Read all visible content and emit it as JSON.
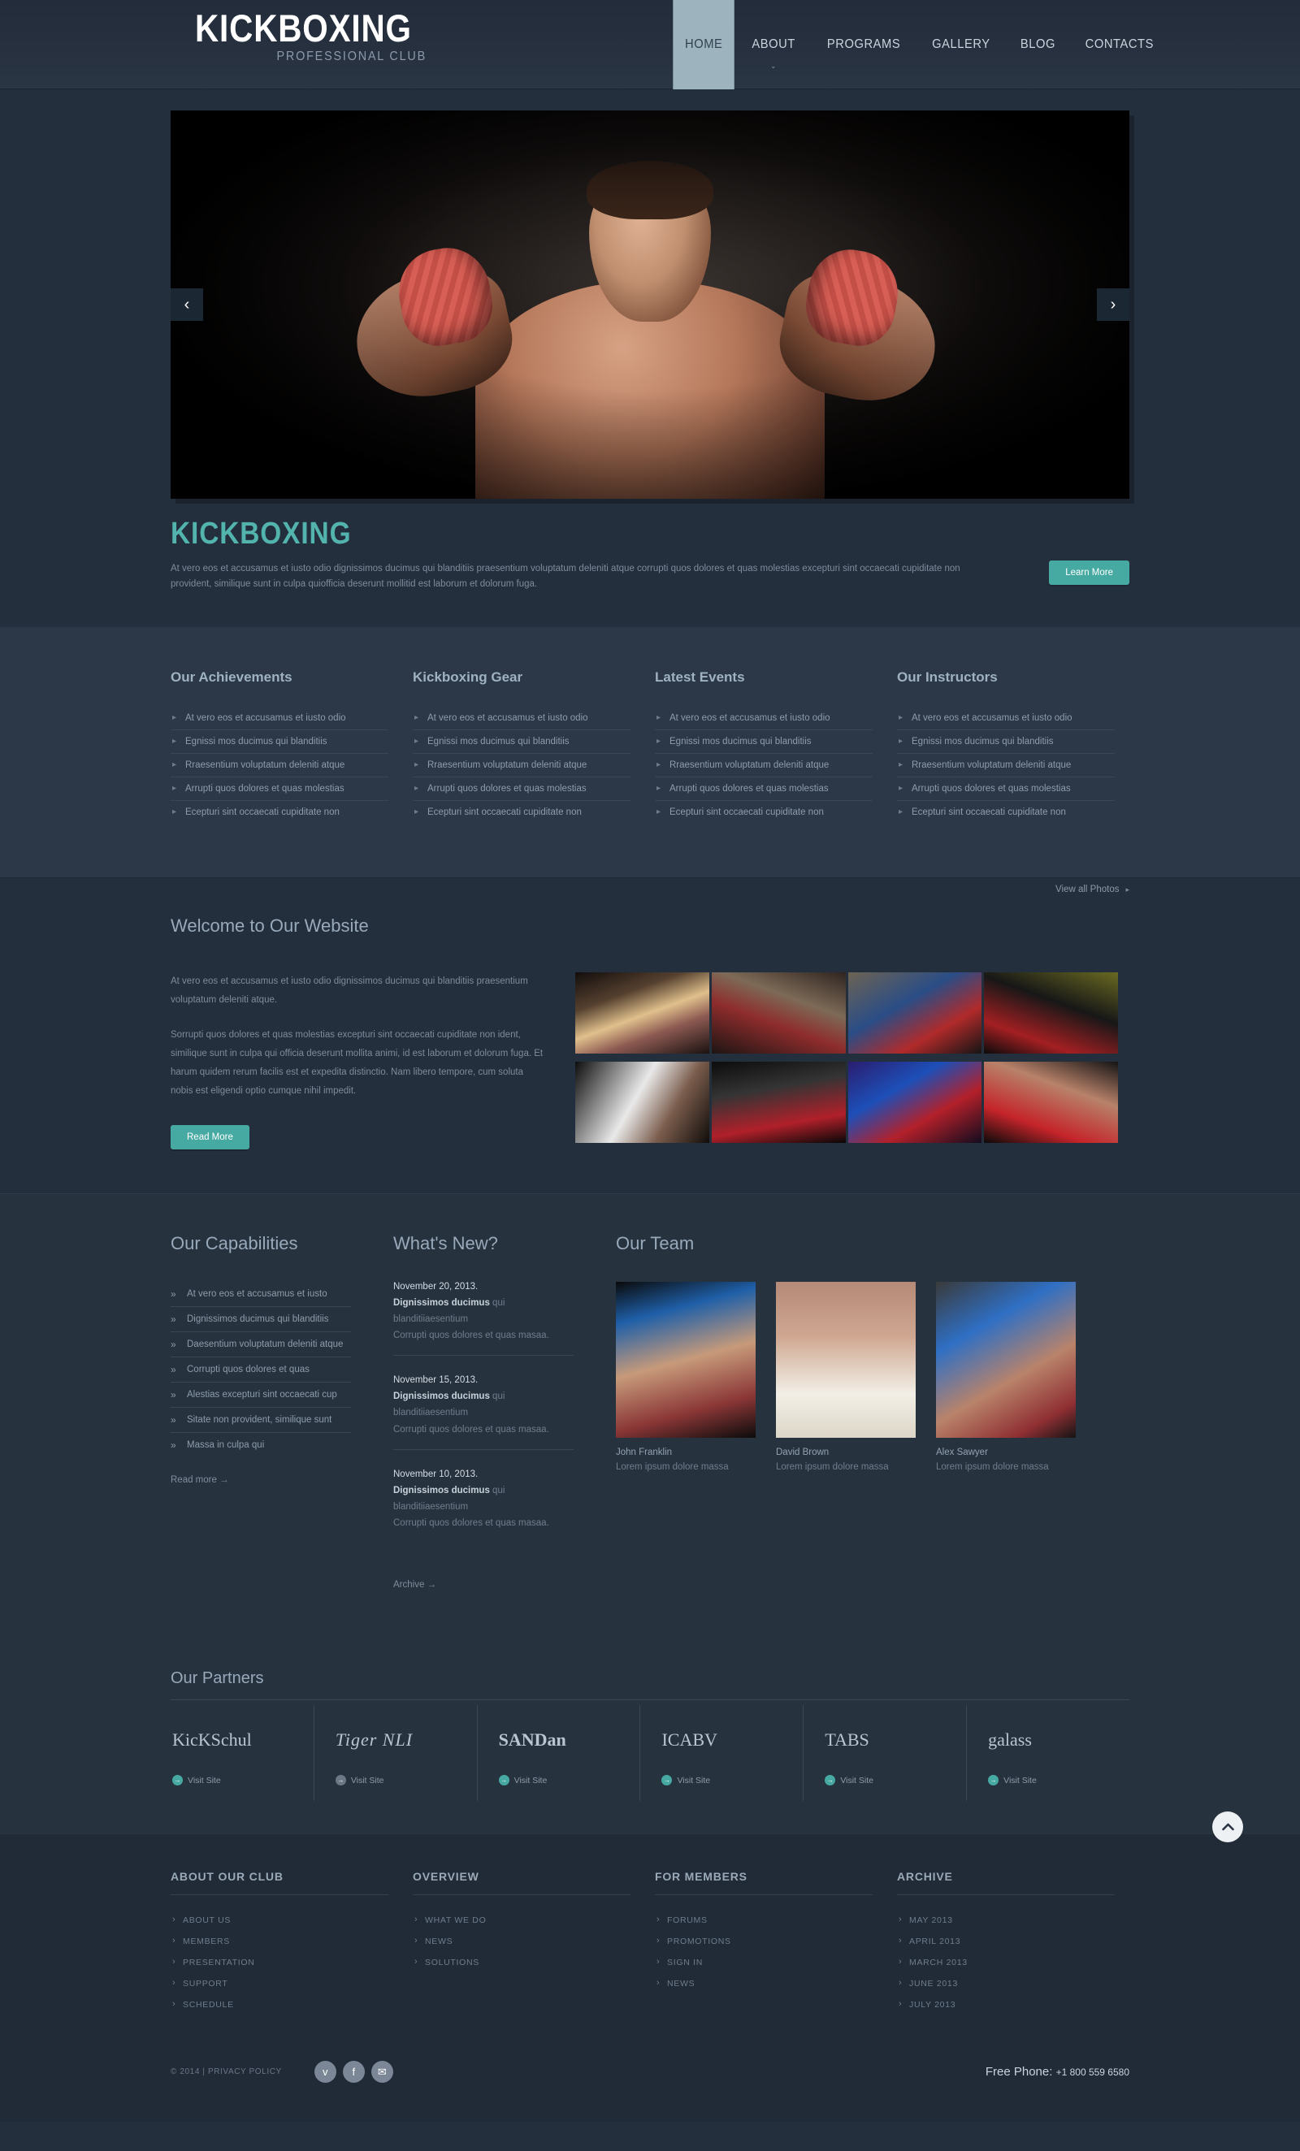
{
  "header": {
    "logo_title": "KICKBOXING",
    "logo_sub": "PROFESSIONAL CLUB",
    "nav": [
      {
        "label": "HOME",
        "active": true,
        "caret": false
      },
      {
        "label": "ABOUT",
        "active": false,
        "caret": true
      },
      {
        "label": "PROGRAMS",
        "active": false,
        "caret": false
      },
      {
        "label": "GALLERY",
        "active": false,
        "caret": false
      },
      {
        "label": "BLOG",
        "active": false,
        "caret": false
      },
      {
        "label": "CONTACTS",
        "active": false,
        "caret": false
      }
    ]
  },
  "slider": {
    "prev": "‹",
    "next": "›",
    "caption_title": "KICKBOXING",
    "caption_text": "At vero eos et accusamus et iusto odio dignissimos ducimus qui blanditiis praesentium voluptatum deleniti atque corrupti quos dolores et quas molestias excepturi sint occaecati cupiditate non provident, similique sunt in culpa quiofficia deserunt mollitid est laborum et dolorum fuga.",
    "button": "Learn More"
  },
  "lists_section": {
    "columns": [
      {
        "title": "Our Achievements",
        "items": [
          "At vero eos et accusamus et iusto odio",
          "Egnissi mos ducimus qui blanditiis",
          "Rraesentium voluptatum deleniti atque",
          "Arrupti quos dolores et quas molestias",
          "Ecepturi sint occaecati cupiditate non"
        ]
      },
      {
        "title": "Kickboxing Gear",
        "items": [
          "At vero eos et accusamus et iusto odio",
          "Egnissi mos ducimus qui blanditiis",
          "Rraesentium voluptatum deleniti atque",
          "Arrupti quos dolores et quas molestias",
          "Ecepturi sint occaecati cupiditate non"
        ]
      },
      {
        "title": "Latest Events",
        "items": [
          "At vero eos et accusamus et iusto odio",
          "Egnissi mos ducimus qui blanditiis",
          "Rraesentium voluptatum deleniti atque",
          "Arrupti quos dolores et quas molestias",
          "Ecepturi sint occaecati cupiditate non"
        ]
      },
      {
        "title": "Our Instructors",
        "items": [
          "At vero eos et accusamus et iusto odio",
          "Egnissi mos ducimus qui blanditiis",
          "Rraesentium voluptatum deleniti atque",
          "Arrupti quos dolores et quas molestias",
          "Ecepturi sint occaecati cupiditate non"
        ]
      }
    ]
  },
  "welcome": {
    "title": "Welcome to Our Website",
    "view_all": "View all Photos",
    "view_all_caret": "▸",
    "paragraph1": "At vero eos et accusamus et iusto odio dignissimos ducimus qui blanditiis praesentium voluptatum deleniti atque.",
    "paragraph2": "Sorrupti quos dolores et quas molestias excepturi sint occaecati cupiditate non ident, similique sunt in culpa qui officia deserunt mollita animi, id est laborum et dolorum fuga. Et harum quidem rerum facilis est et expedita distinctio. Nam libero tempore, cum soluta nobis est eligendi optio cumque nihil impedit.",
    "button": "Read More",
    "gallery_alt": [
      "female-boxer-pink-top",
      "sparring-partners-pads",
      "two-boxers-clinch-ring",
      "hooded-boxer-red-gloves",
      "male-boxer-spotlight",
      "boxer-in-dark-ring",
      "boxing-ring-bell-blue",
      "boxer-red-gloves-portrait"
    ]
  },
  "capabilities": {
    "title": "Our Capabilities",
    "items": [
      "At vero eos et accusamus et iusto",
      "Dignissimos ducimus qui blanditiis",
      "Daesentium voluptatum deleniti atque",
      "Corrupti quos dolores et quas",
      "Alestias excepturi sint occaecati cup",
      "Sitate non provident, similique sunt",
      "Massa in culpa qui"
    ],
    "more": "Read more →"
  },
  "whats_new": {
    "title": "What's New?",
    "items": [
      {
        "date": "November 20, 2013.",
        "strong": "Dignissimos ducimus",
        "rest": " qui blanditiiaesentium",
        "line2": "Corrupti quos dolores et quas masaa."
      },
      {
        "date": "November 15, 2013.",
        "strong": "Dignissimos ducimus",
        "rest": " qui blanditiiaesentium",
        "line2": "Corrupti quos dolores et quas masaa."
      },
      {
        "date": "November 10, 2013.",
        "strong": "Dignissimos ducimus",
        "rest": " qui blanditiiaesentium",
        "line2": "Corrupti quos dolores et quas masaa."
      }
    ],
    "more": "Archive →"
  },
  "team": {
    "title": "Our Team",
    "members": [
      {
        "name": "John Franklin",
        "role": "Lorem ipsum dolore massa"
      },
      {
        "name": "David Brown",
        "role": "Lorem ipsum dolore massa"
      },
      {
        "name": "Alex Sawyer",
        "role": "Lorem ipsum dolore massa"
      }
    ]
  },
  "partners": {
    "title": "Our Partners",
    "items": [
      {
        "logo": "KicKSchul",
        "link": "Visit Site",
        "dot_grey": false
      },
      {
        "logo": "Tiger NLI",
        "link": "Visit Site",
        "dot_grey": true
      },
      {
        "logo": "SANDan",
        "link": "Visit Site",
        "dot_grey": false
      },
      {
        "logo": "ICABV",
        "link": "Visit Site",
        "dot_grey": false
      },
      {
        "logo": "TABS",
        "link": "Visit Site",
        "dot_grey": false
      },
      {
        "logo": "galass",
        "link": "Visit Site",
        "dot_grey": false
      }
    ]
  },
  "footer": {
    "columns": [
      {
        "title": "ABOUT OUR CLUB",
        "items": [
          "ABOUT US",
          "MEMBERS",
          "PRESENTATION",
          "SUPPORT",
          "SCHEDULE"
        ]
      },
      {
        "title": "OVERVIEW",
        "items": [
          "WHAT WE DO",
          "NEWS",
          "SOLUTIONS"
        ]
      },
      {
        "title": "FOR MEMBERS",
        "items": [
          "FORUMS",
          "PROMOTIONS",
          "SIGN IN",
          "NEWS"
        ]
      },
      {
        "title": "ARCHIVE",
        "items": [
          "MAY 2013",
          "APRIL 2013",
          "MARCH 2013",
          "JUNE 2013",
          "JULY 2013"
        ]
      }
    ],
    "copyright": "© 2014 | PRIVACY POLICY",
    "socials": [
      "twitter-icon",
      "facebook-icon",
      "mail-icon"
    ],
    "social_glyphs": [
      "ᴠ",
      "f",
      "✉"
    ],
    "phone_label": "Free Phone:",
    "phone_number": "+1 800 559 6580",
    "to_top": "⌃"
  },
  "colors": {
    "accent_teal": "#46a9a2",
    "caption_teal": "#52b4ad",
    "bg_dark": "#242f3e",
    "bg_light": "#2c3848",
    "bg_mid": "#27323f",
    "footer_bg": "#212b38",
    "nav_active": "#9db4bf"
  }
}
